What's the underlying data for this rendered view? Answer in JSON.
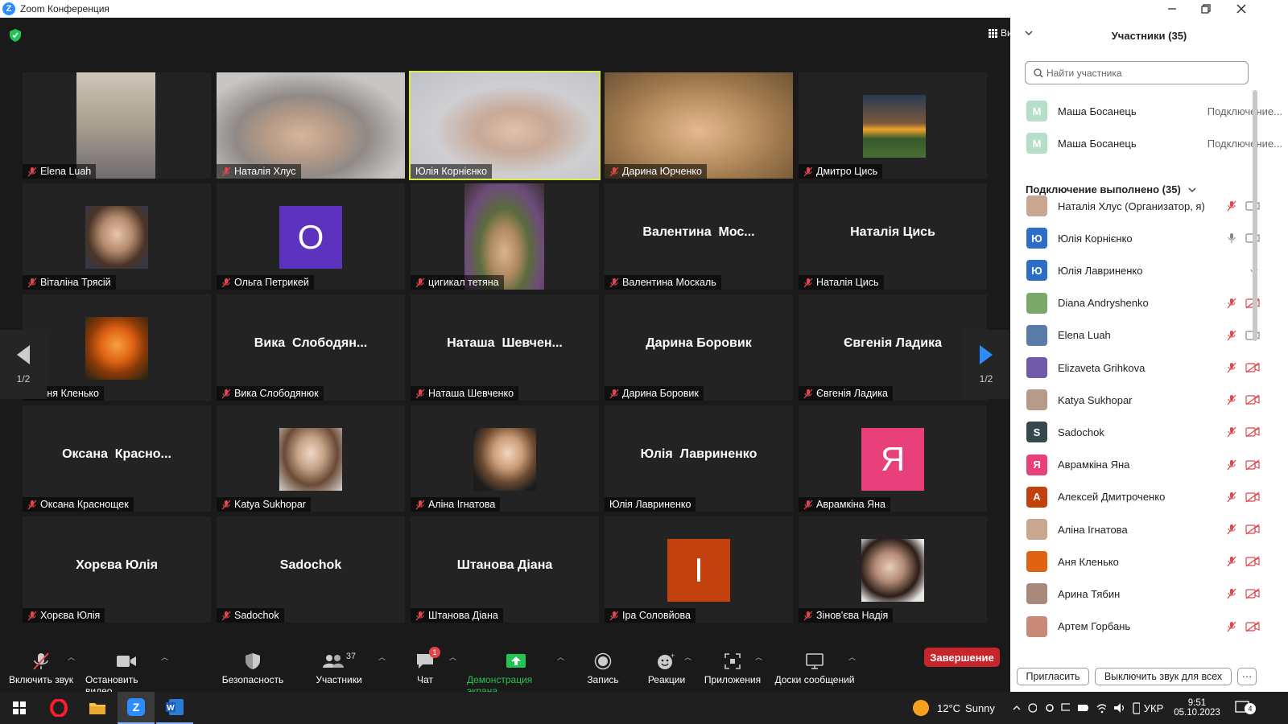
{
  "window": {
    "title": "Zoom Конференция"
  },
  "view": {
    "label": "Вид"
  },
  "pager": {
    "label": "1/2"
  },
  "tiles": [
    {
      "name": "Elena Luah"
    },
    {
      "name": "Наталія Хлус"
    },
    {
      "name": "Юлія Корнієнко"
    },
    {
      "name": "Дарина Юрченко"
    },
    {
      "name": "Дмитро Цись"
    },
    {
      "name": "Віталіна Трясій"
    },
    {
      "name": "Ольга Петрикей",
      "avatar": "O"
    },
    {
      "name": "цигикал тетяна"
    },
    {
      "name": "Валентина Москаль",
      "big": "Валентина  Мос..."
    },
    {
      "name": "Наталія Цись",
      "big": "Наталія Цись"
    },
    {
      "name": "Аня Кленько"
    },
    {
      "name": "Вика Слободянюк",
      "big": "Вика  Слободян..."
    },
    {
      "name": "Наташа Шевченко",
      "big": "Наташа  Шевчен..."
    },
    {
      "name": "Дарина Боровик",
      "big": "Дарина Боровик"
    },
    {
      "name": "Євгенія Ладика",
      "big": "Євгенія Ладика"
    },
    {
      "name": "Оксана Краснощек",
      "big": "Оксана  Красно..."
    },
    {
      "name": "Katya Sukhopar"
    },
    {
      "name": "Аліна Ігнатова"
    },
    {
      "name": "Юлія Лавриненко",
      "big": "Юлія  Лавриненко"
    },
    {
      "name": "Аврамкіна Яна",
      "avatar": "Я"
    },
    {
      "name": "Хорєва Юлія",
      "big": "Хорєва Юлія"
    },
    {
      "name": "Sadochok",
      "big": "Sadochok"
    },
    {
      "name": "Штанова Діана",
      "big": "Штанова Діана"
    },
    {
      "name": "Іра Соловйова",
      "avatar": "I"
    },
    {
      "name": "Зінов'єва Надія"
    }
  ],
  "toolbar": {
    "unmute": "Включить звук",
    "stop_video": "Остановить видео",
    "security": "Безопасность",
    "participants": "Участники",
    "participants_count": "37",
    "chat": "Чат",
    "chat_badge": "1",
    "share": "Демонстрация экрана",
    "record": "Запись",
    "reactions": "Реакции",
    "apps": "Приложения",
    "whiteboards": "Доски сообщений",
    "end": "Завершение"
  },
  "panel": {
    "title": "Участники (35)",
    "search_placeholder": "Найти участника",
    "connecting": [
      {
        "initial": "M",
        "name": "Маша Босанець",
        "status": "Подключение..."
      },
      {
        "initial": "M",
        "name": "Маша Босанець",
        "status": "Подключение..."
      }
    ],
    "section": "Подключение выполнено (35)",
    "participants": [
      {
        "initial": "",
        "name": "Наталія Хлус (Организатор, я)"
      },
      {
        "initial": "Ю",
        "name": "Юлія Корнієнко"
      },
      {
        "initial": "Ю",
        "name": "Юлія Лавриненко"
      },
      {
        "initial": "",
        "name": "Diana Andryshenko"
      },
      {
        "initial": "",
        "name": "Elena Luah"
      },
      {
        "initial": "",
        "name": "Elizaveta Grihkova"
      },
      {
        "initial": "",
        "name": "Katya Sukhopar"
      },
      {
        "initial": "S",
        "name": "Sadochok"
      },
      {
        "initial": "Я",
        "name": "Аврамкіна Яна"
      },
      {
        "initial": "А",
        "name": "Алексей Дмитроченко"
      },
      {
        "initial": "",
        "name": "Аліна Ігнатова"
      },
      {
        "initial": "",
        "name": "Аня Кленько"
      },
      {
        "initial": "",
        "name": "Арина Тябин"
      },
      {
        "initial": "",
        "name": "Артем Горбань"
      }
    ],
    "invite": "Пригласить",
    "mute_all": "Выключить звук для всех",
    "more": "···"
  },
  "taskbar": {
    "temperature": "12°C",
    "weather": "Sunny",
    "language": "УКР",
    "time": "9:51",
    "date": "05.10.2023",
    "notifications": "4"
  },
  "colors": {
    "accent": "#2d8cff",
    "end": "#c7252b",
    "active_speaker": "#d9e84a",
    "share": "#23c552",
    "mute_red": "#e0474c"
  }
}
